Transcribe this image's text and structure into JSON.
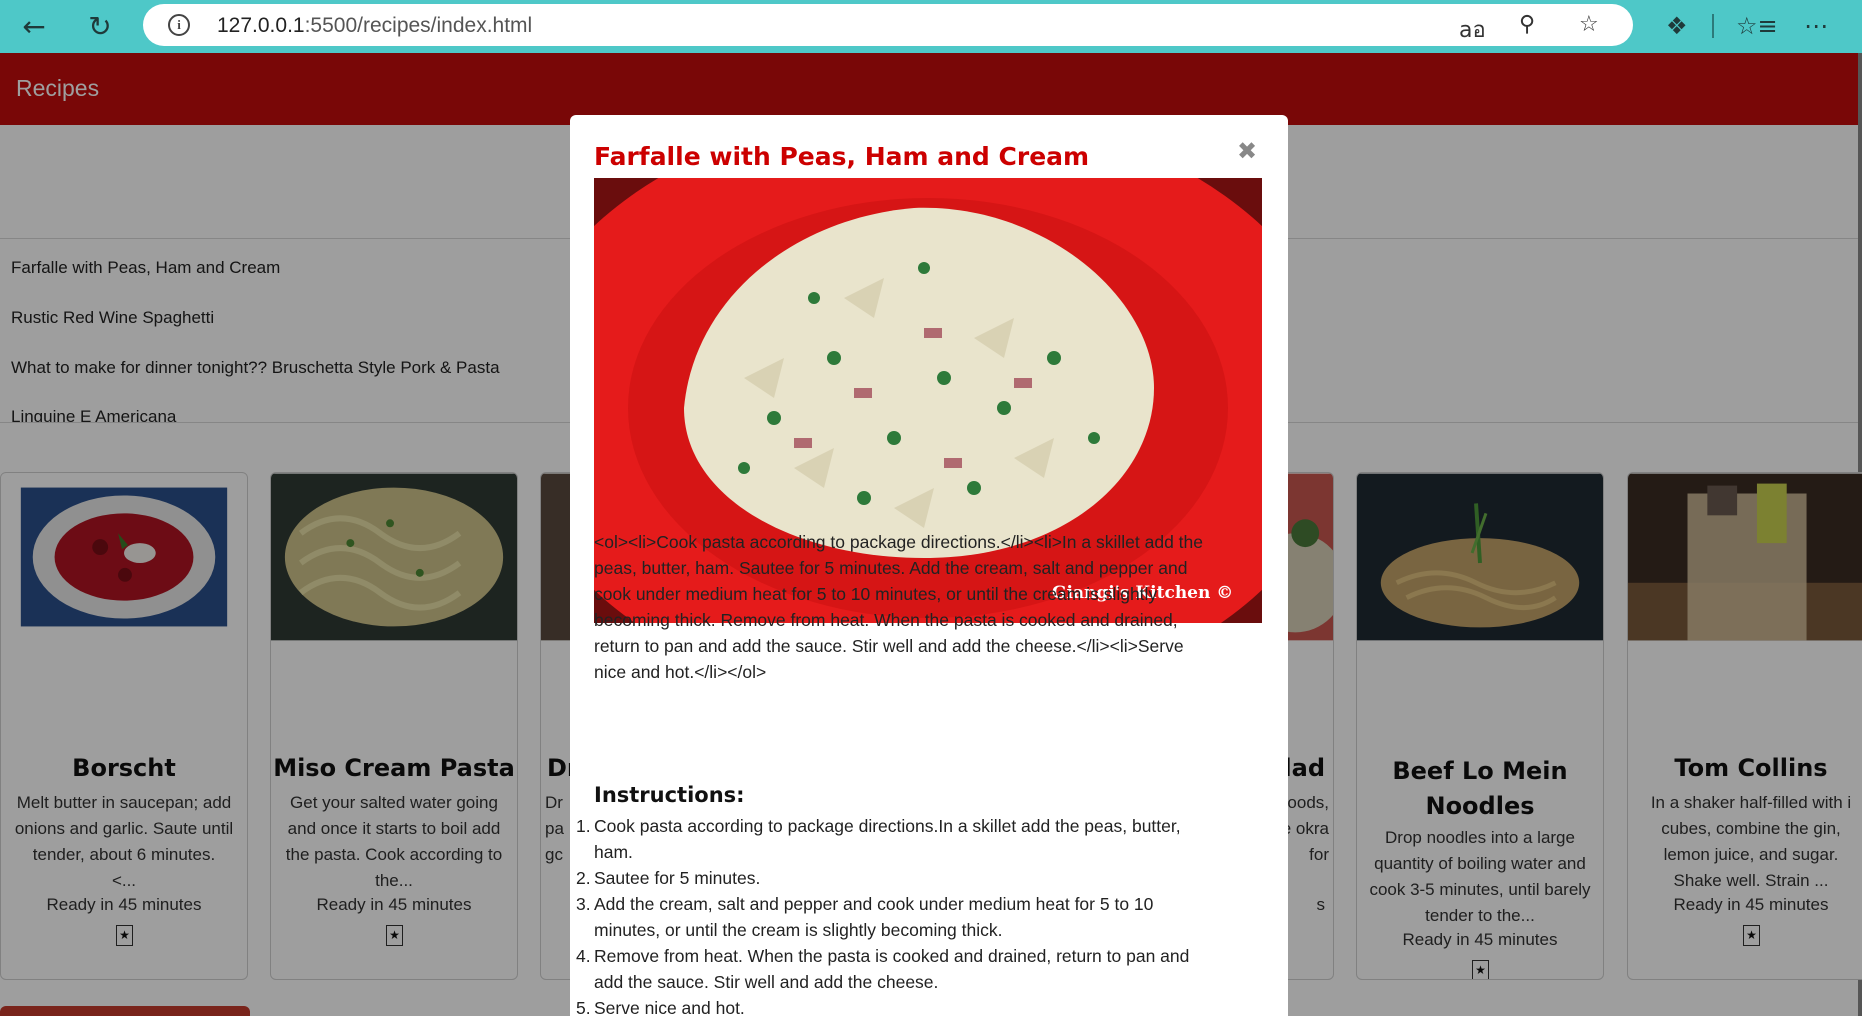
{
  "browser": {
    "url_host": "127.0.0.1",
    "url_path": ":5500/recipes/index.html",
    "icons": [
      "back-arrow-icon",
      "reload-icon",
      "info-icon",
      "read-aloud-icon",
      "zoom-icon",
      "favorite-star-icon",
      "extensions-icon",
      "favorites-list-icon",
      "more-icon"
    ]
  },
  "app": {
    "title": "Recipes",
    "colors": {
      "header": "#c40c0c",
      "modal_title": "#cc0000"
    }
  },
  "recipe_list": [
    "Farfalle with Peas, Ham and Cream",
    "Rustic Red Wine Spaghetti",
    "What to make for dinner tonight?? Bruschetta Style Pork & Pasta",
    "Linguine E Americana"
  ],
  "cards": [
    {
      "title": "Borscht",
      "desc": [
        "Melt butter in saucepan; add",
        "onions and garlic. Saute until",
        "tender, about 6 minutes.",
        "<..."
      ],
      "ready": "Ready in 45 minutes",
      "star": "★"
    },
    {
      "title": "Miso Cream Pasta",
      "desc": [
        "Get your salted water going",
        "and once it starts to boil add",
        "the pasta. Cook according to",
        "the..."
      ],
      "ready": "Ready in 45 minutes",
      "star": "★"
    },
    {
      "title": "Dr",
      "desc": [
        "Dr",
        "pa",
        "gc"
      ],
      "ready": "",
      "star": ""
    },
    {
      "title": "lad",
      "desc": [
        "oods,",
        "e okra",
        "for"
      ],
      "ready": "s",
      "star": ""
    },
    {
      "title_lines": [
        "Beef Lo Mein",
        "Noodles"
      ],
      "desc": [
        "Drop noodles into a large",
        "quantity of boiling water and",
        "cook 3-5 minutes, until barely",
        "tender to the..."
      ],
      "ready": "Ready in 45 minutes",
      "star": "★"
    },
    {
      "title": "Tom Collins",
      "desc": [
        "In a shaker half-filled with i",
        "cubes, combine the gin,",
        "lemon juice, and sugar.",
        "Shake well. Strain ..."
      ],
      "ready": "Ready in 45 minutes",
      "star": "★"
    }
  ],
  "modal": {
    "title": "Farfalle with Peas, Ham and Cream",
    "close": "✖",
    "image_watermark": "Giangi's Kitchen ©",
    "raw_lines": [
      "<ol><li>Cook pasta according to package directions.</li><li>In a skillet add the",
      "peas, butter, ham. Sautee for 5 minutes. Add the cream, salt and pepper and",
      "cook under medium heat for 5 to 10 minutes, or until the cream is slightly",
      "becoming thick. Remove from heat. When the pasta is cooked and drained,",
      "return to pan and add the sauce. Stir well and add the cheese.</li><li>Serve",
      "nice and hot.</li></ol>"
    ],
    "instructions_heading": "Instructions:",
    "steps": [
      {
        "num": "1.",
        "lines": [
          "Cook pasta according to package directions.In a skillet add the peas, butter,",
          "ham."
        ]
      },
      {
        "num": "2.",
        "lines": [
          "Sautee for 5 minutes."
        ]
      },
      {
        "num": "3.",
        "lines": [
          "Add the cream, salt and pepper and cook under medium heat for 5 to 10",
          "minutes, or until the cream is slightly becoming thick."
        ]
      },
      {
        "num": "4.",
        "lines": [
          "Remove from heat. When the pasta is cooked and drained, return to pan and",
          "add the sauce. Stir well and add the cheese."
        ]
      },
      {
        "num": "5.",
        "lines": [
          "Serve nice and hot."
        ]
      }
    ]
  }
}
